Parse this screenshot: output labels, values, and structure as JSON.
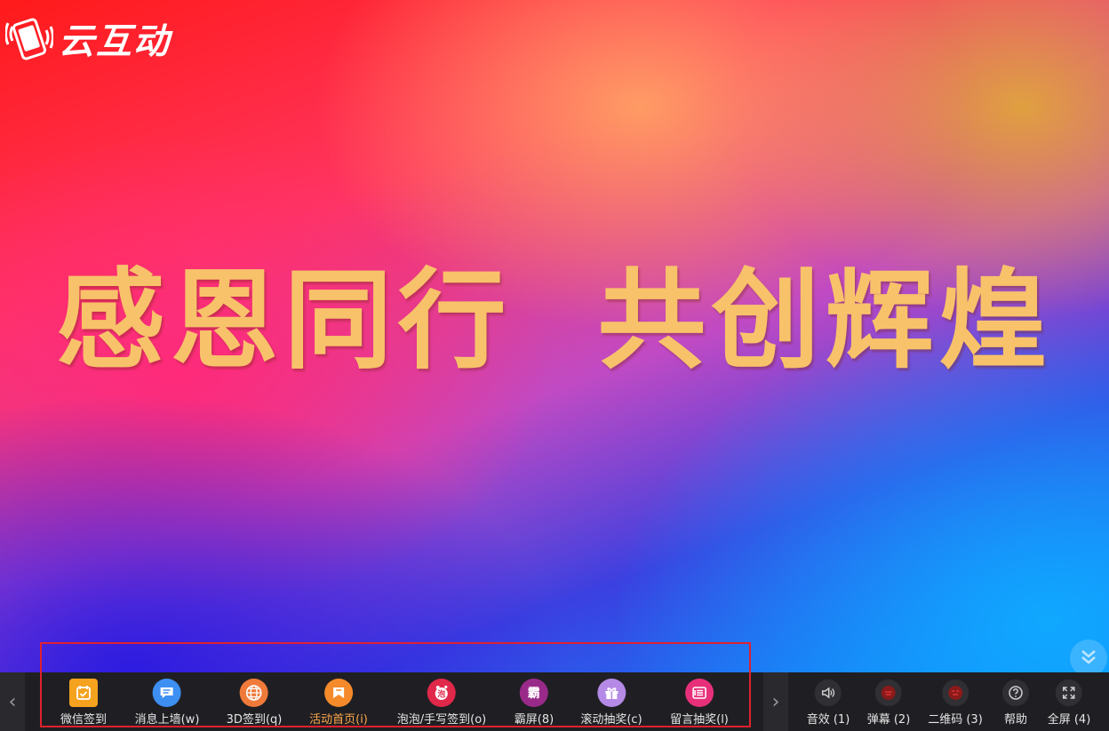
{
  "brand": {
    "name": "云互动",
    "icon": "phone-wave-icon"
  },
  "slogan": "感恩同行  共创辉煌",
  "toolbar": {
    "items": [
      {
        "label": "微信签到",
        "icon": "calendar-check-icon",
        "color": "#f5a21e"
      },
      {
        "label": "消息上墙(w)",
        "icon": "chat-bubble-icon",
        "color": "#3d8ff2"
      },
      {
        "label": "3D签到(q)",
        "icon": "globe-icon",
        "color": "#f07a3a"
      },
      {
        "label": "活动首页(i)",
        "icon": "home-flag-icon",
        "color": "#f58a2a"
      },
      {
        "label": "泡泡/手写签到(o)",
        "icon": "bubble-pen-icon",
        "color": "#e0284a"
      },
      {
        "label": "霸屏(8)",
        "icon": "ba-screen-icon",
        "color": "#9a2a8a"
      },
      {
        "label": "滚动抽奖(c)",
        "icon": "gift-icon",
        "color": "#b58ae6"
      },
      {
        "label": "留言抽奖(l)",
        "icon": "message-list-icon",
        "color": "#e8307a"
      }
    ],
    "active_index": 3,
    "active_color": "#ffa64a"
  },
  "right_tools": {
    "items": [
      {
        "label": "音效 (1)",
        "icon": "speaker-icon"
      },
      {
        "label": "弹幕 (2)",
        "icon": "danmaku-icon"
      },
      {
        "label": "二维码 (3)",
        "icon": "qrcode-icon"
      },
      {
        "label": "帮助",
        "icon": "help-icon"
      },
      {
        "label": "全屏 (4)",
        "icon": "fullscreen-icon"
      }
    ]
  },
  "nav": {
    "prev": "‹",
    "next": "›"
  }
}
